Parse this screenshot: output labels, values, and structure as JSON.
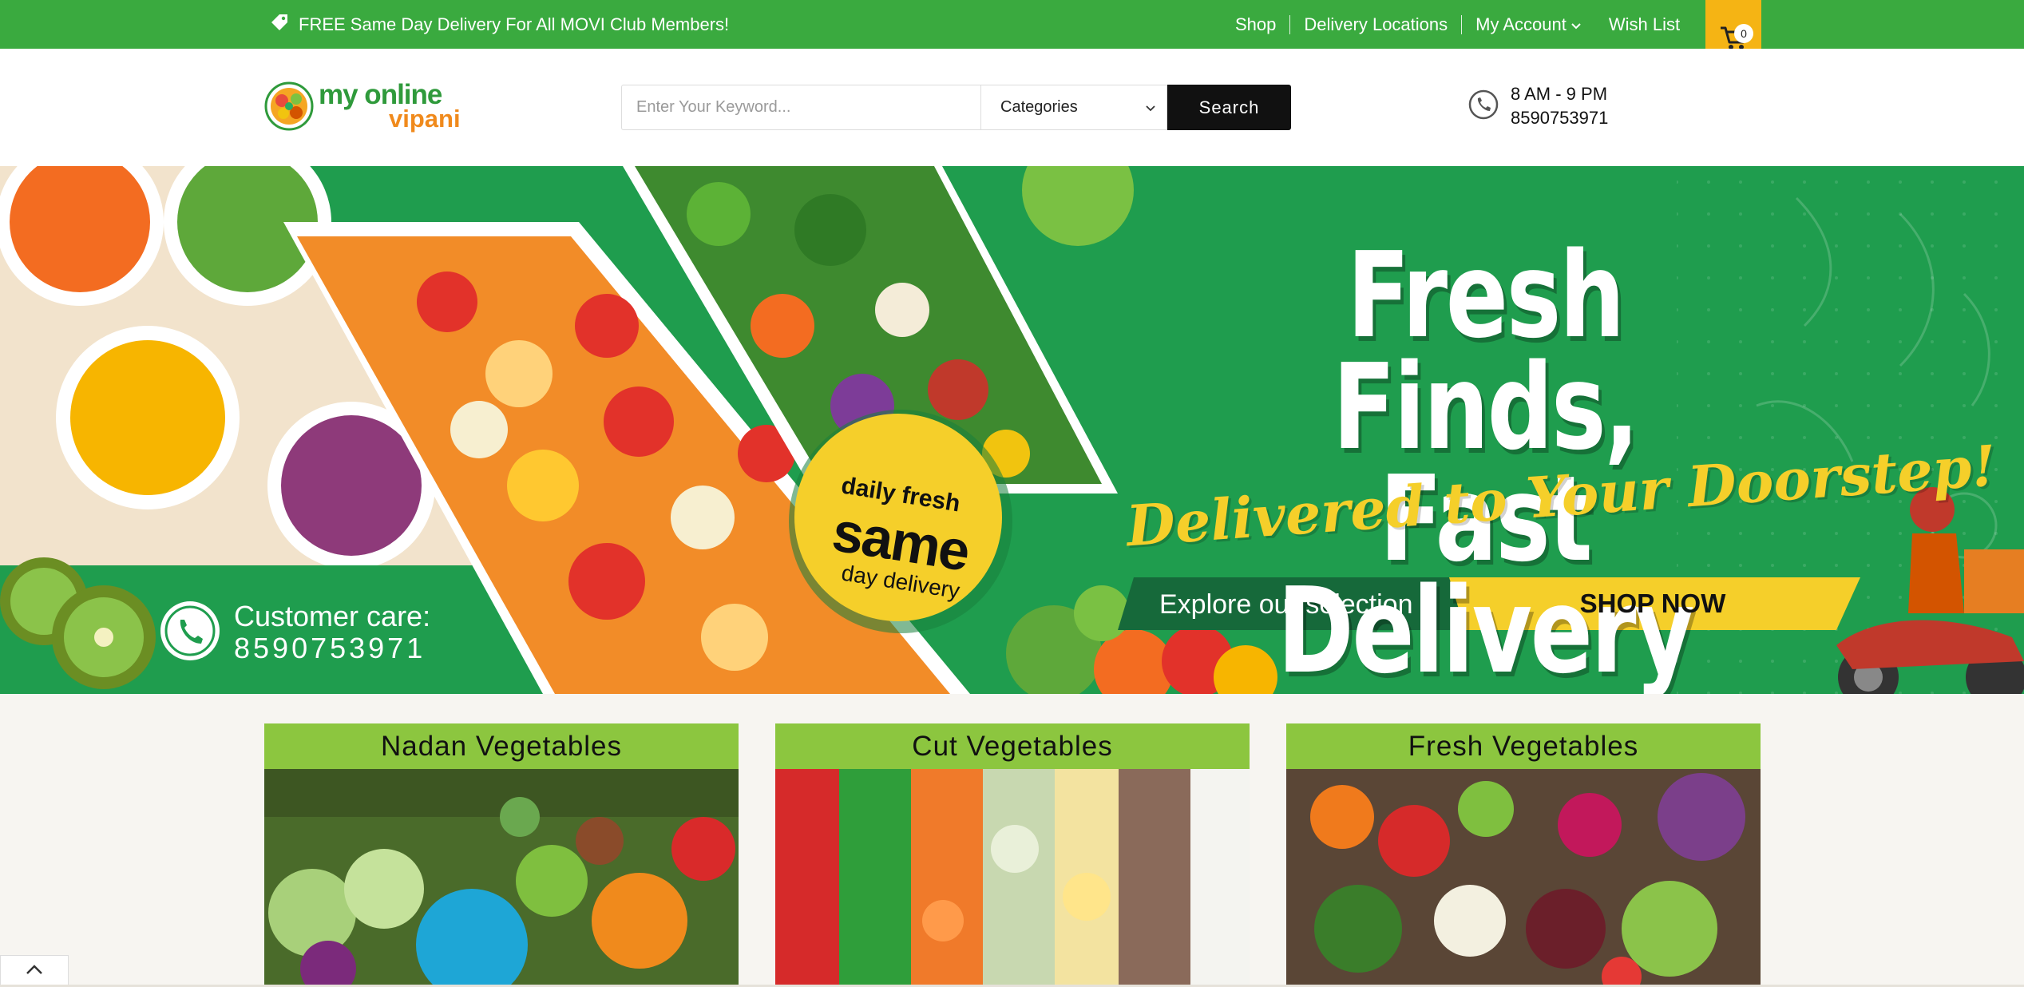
{
  "topbar": {
    "promo": "FREE Same Day Delivery For All MOVI Club Members!",
    "nav": [
      "Shop",
      "Delivery Locations",
      "My Account",
      "Wish List"
    ],
    "cart_count": "0"
  },
  "header": {
    "logo_line1": "my online",
    "logo_line2": "vipani",
    "search_placeholder": "Enter Your Keyword...",
    "categories_label": "Categories",
    "search_button": "Search",
    "hours": "8 AM - 9 PM",
    "phone": "8590753971"
  },
  "hero": {
    "headline_line1": "Fresh Finds,",
    "headline_line2": "Fast Delivery",
    "tagline": "Delivered to Your Doorstep!",
    "explore": "Explore our selection",
    "shop_now": "SHOP NOW",
    "care_label": "Customer care:",
    "care_number": "8590753971",
    "badge_line1": "daily fresh",
    "badge_line2": "same",
    "badge_line3": "day delivery"
  },
  "categories": [
    {
      "title": "Nadan Vegetables"
    },
    {
      "title": "Cut Vegetables"
    },
    {
      "title": "Fresh Vegetables"
    }
  ],
  "colors": {
    "topbar_green": "#3aaa3f",
    "hero_green": "#1f9d4e",
    "card_green": "#8cc63f",
    "accent_yellow": "#f5cf2a",
    "cart_orange": "#f5b414"
  },
  "icons": {
    "promo": "tag-icon",
    "cart": "cart-icon",
    "contact": "phone-icon",
    "dropdown": "chevron-down-icon",
    "scroll": "chevron-up-icon"
  }
}
